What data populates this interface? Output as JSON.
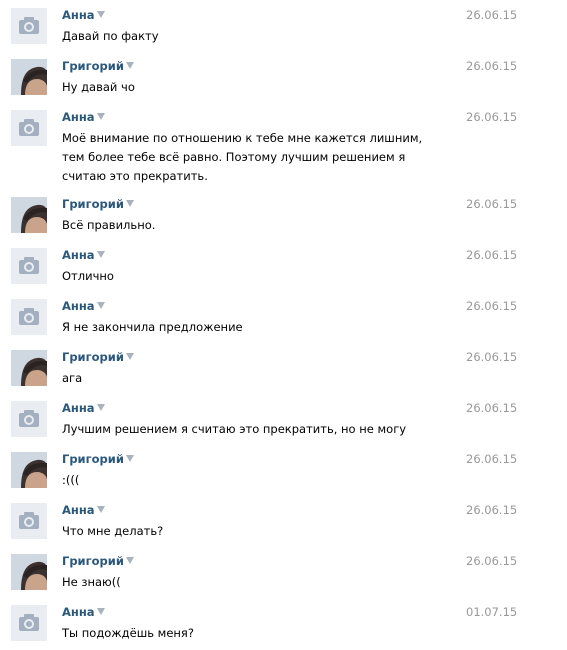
{
  "icons": {
    "anna_avatar": "camera-icon",
    "grigory_avatar": "user-photo"
  },
  "messages": [
    {
      "author": "Анна",
      "date": "26.06.15",
      "text": "Давай по факту"
    },
    {
      "author": "Григорий",
      "date": "26.06.15",
      "text": "Ну давай чо"
    },
    {
      "author": "Анна",
      "date": "26.06.15",
      "text": "Моё внимание по отношению к тебе мне кажется лишним, тем более тебе всё равно. Поэтому лучшим решением я считаю это прекратить."
    },
    {
      "author": "Григорий",
      "date": "26.06.15",
      "text": "Всё правильно."
    },
    {
      "author": "Анна",
      "date": "26.06.15",
      "text": "Отлично"
    },
    {
      "author": "Анна",
      "date": "26.06.15",
      "text": "Я не закончила предложение"
    },
    {
      "author": "Григорий",
      "date": "26.06.15",
      "text": "ага"
    },
    {
      "author": "Анна",
      "date": "26.06.15",
      "text": "Лучшим решением я считаю это прекратить, но не могу"
    },
    {
      "author": "Григорий",
      "date": "26.06.15",
      "text": ":((("
    },
    {
      "author": "Анна",
      "date": "26.06.15",
      "text": "Что мне делать?"
    },
    {
      "author": "Григорий",
      "date": "26.06.15",
      "text": "Не знаю(("
    },
    {
      "author": "Анна",
      "date": "01.07.15",
      "text": "Ты подождёшь меня?"
    }
  ]
}
